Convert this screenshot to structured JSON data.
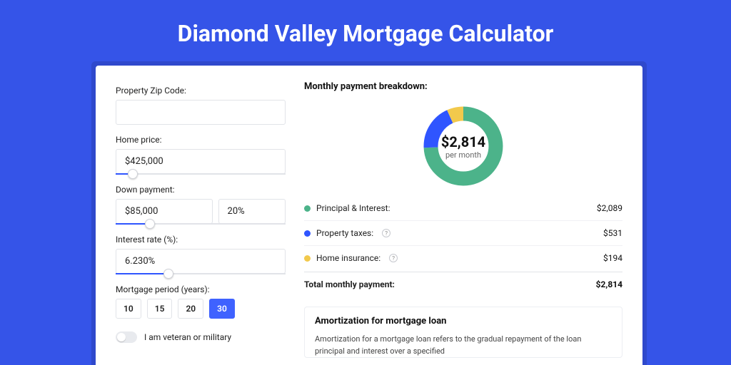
{
  "title": "Diamond Valley Mortgage Calculator",
  "form": {
    "zip_label": "Property Zip Code:",
    "zip_value": "",
    "home_price_label": "Home price:",
    "home_price_value": "$425,000",
    "down_payment_label": "Down payment:",
    "down_payment_value": "$85,000",
    "down_payment_pct": "20%",
    "interest_label": "Interest rate (%):",
    "interest_value": "6.230%",
    "period_label": "Mortgage period (years):",
    "period_options": [
      "10",
      "15",
      "20",
      "30"
    ],
    "period_selected": "30",
    "veteran_label": "I am veteran or military",
    "veteran_checked": false
  },
  "breakdown": {
    "section_title": "Monthly payment breakdown:",
    "donut_amount": "$2,814",
    "donut_sub": "per month",
    "items": [
      {
        "label": "Principal & Interest:",
        "value": "$2,089",
        "color": "#4cb38a",
        "info": false
      },
      {
        "label": "Property taxes:",
        "value": "$531",
        "color": "#2f55ff",
        "info": true
      },
      {
        "label": "Home insurance:",
        "value": "$194",
        "color": "#f2c94c",
        "info": true
      }
    ],
    "total_label": "Total monthly payment:",
    "total_value": "$2,814"
  },
  "amortization": {
    "title": "Amortization for mortgage loan",
    "text": "Amortization for a mortgage loan refers to the gradual repayment of the loan principal and interest over a specified"
  },
  "chart_data": {
    "type": "pie",
    "title": "Monthly payment breakdown",
    "categories": [
      "Principal & Interest",
      "Property taxes",
      "Home insurance"
    ],
    "values": [
      2089,
      531,
      194
    ],
    "colors": [
      "#4cb38a",
      "#2f55ff",
      "#f2c94c"
    ],
    "center_label": "$2,814 per month",
    "total": 2814
  }
}
